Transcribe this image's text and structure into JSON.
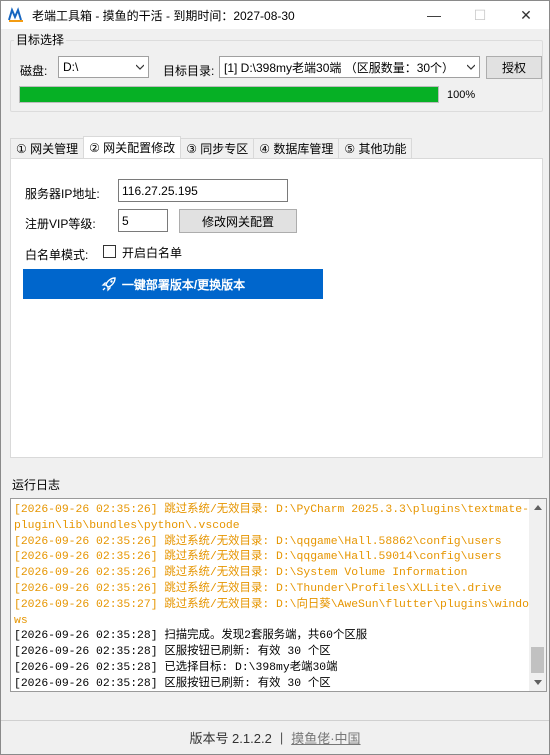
{
  "window": {
    "title": "老端工具箱 - 摸鱼的干活 - 到期时间：2027-08-30",
    "minimize": "—",
    "maximize": "☐",
    "close": "✕"
  },
  "target": {
    "group_label": "目标选择",
    "disk_label": "磁盘:",
    "disk_value": "D:\\",
    "dir_label": "目标目录:",
    "dir_value": "[1] D:\\398my老端30端 （区服数量：30个）",
    "auth_button": "授权",
    "progress": 100,
    "progress_text": "100%"
  },
  "tabs": [
    {
      "label": "① 网关管理",
      "active": false
    },
    {
      "label": "② 网关配置修改",
      "active": true
    },
    {
      "label": "③ 同步专区",
      "active": false
    },
    {
      "label": "④ 数据库管理",
      "active": false
    },
    {
      "label": "⑤ 其他功能",
      "active": false
    }
  ],
  "gateway": {
    "ip_label": "服务器IP地址:",
    "ip_value": "116.27.25.195",
    "vip_label": "注册VIP等级:",
    "vip_value": "5",
    "modify_button": "修改网关配置",
    "whitelist_label": "白名单模式:",
    "whitelist_checkbox_label": "开启白名单",
    "whitelist_checked": false,
    "deploy_button": "一键部署版本/更换版本"
  },
  "log": {
    "label": "运行日志",
    "lines": [
      {
        "text": "[2026-09-26 02:35:26] 跳过系统/无效目录: D:\\PyCharm 2025.3.3\\plugins\\textmate-plugin\\lib\\bundles\\python\\.vscode",
        "level": "warn"
      },
      {
        "text": "[2026-09-26 02:35:26] 跳过系统/无效目录: D:\\qqgame\\Hall.58862\\config\\users",
        "level": "warn"
      },
      {
        "text": "[2026-09-26 02:35:26] 跳过系统/无效目录: D:\\qqgame\\Hall.59014\\config\\users",
        "level": "warn"
      },
      {
        "text": "[2026-09-26 02:35:26] 跳过系统/无效目录: D:\\System Volume Information",
        "level": "warn"
      },
      {
        "text": "[2026-09-26 02:35:26] 跳过系统/无效目录: D:\\Thunder\\Profiles\\XLLite\\.drive",
        "level": "warn"
      },
      {
        "text": "[2026-09-26 02:35:27] 跳过系统/无效目录: D:\\向日葵\\AweSun\\flutter\\plugins\\windows",
        "level": "warn"
      },
      {
        "text": "[2026-09-26 02:35:28] 扫描完成。发现2套服务端，共60个区服",
        "level": "info"
      },
      {
        "text": "[2026-09-26 02:35:28] 区服按钮已刷新: 有效 30 个区",
        "level": "info"
      },
      {
        "text": "[2026-09-26 02:35:28] 已选择目标: D:\\398my老端30端",
        "level": "info"
      },
      {
        "text": "[2026-09-26 02:35:28] 区服按钮已刷新: 有效 30 个区",
        "level": "info"
      }
    ]
  },
  "footer": {
    "version": "版本号 2.1.2.2",
    "separator": "|",
    "link": "摸鱼佬·中国"
  },
  "colors": {
    "progress": "#06b025",
    "deploy_button": "#0066cc",
    "log_warn": "#e69500"
  },
  "icons": {
    "app": "app-logo-icon",
    "rocket": "rocket-icon",
    "combo_arrow": "chevron-down-icon"
  }
}
